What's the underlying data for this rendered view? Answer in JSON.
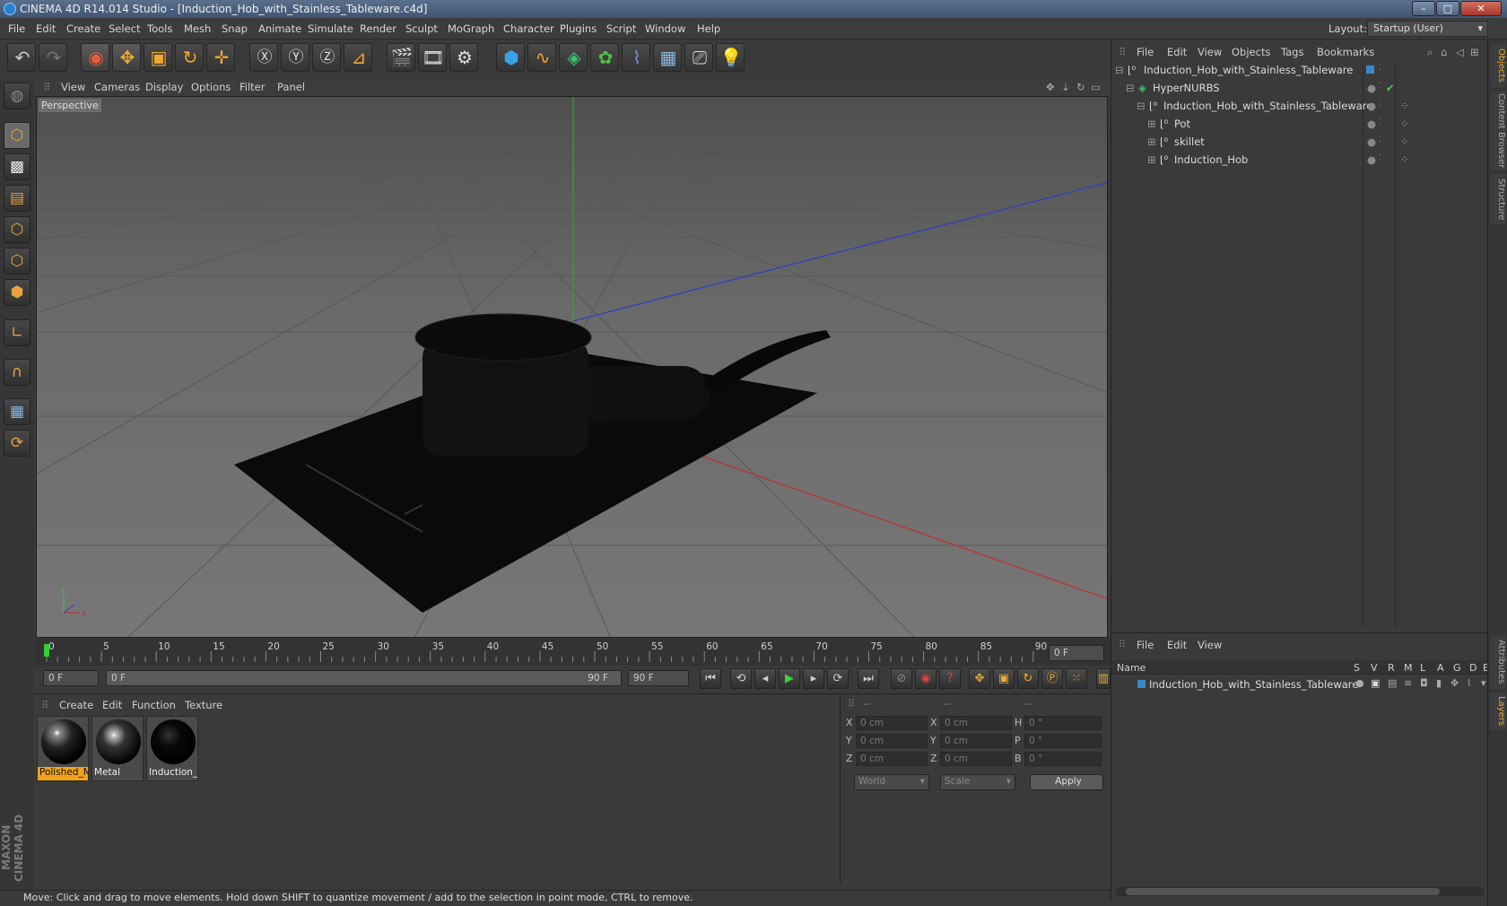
{
  "window": {
    "title": "CINEMA 4D R14.014 Studio - [Induction_Hob_with_Stainless_Tableware.c4d]",
    "controls": [
      "minimize",
      "maximize",
      "close"
    ]
  },
  "menubar": {
    "items": [
      "File",
      "Edit",
      "Create",
      "Select",
      "Tools",
      "Mesh",
      "Snap",
      "Animate",
      "Simulate",
      "Render",
      "Sculpt",
      "MoGraph",
      "Character",
      "Plugins",
      "Script",
      "Window",
      "Help"
    ],
    "layout_label": "Layout:",
    "layout_value": "Startup (User)"
  },
  "viewport": {
    "menu": [
      "View",
      "Cameras",
      "Display",
      "Options",
      "Filter",
      "Panel"
    ],
    "label": "Perspective"
  },
  "timeline": {
    "ticks": [
      "0",
      "5",
      "10",
      "15",
      "20",
      "25",
      "30",
      "35",
      "40",
      "45",
      "50",
      "55",
      "60",
      "65",
      "70",
      "75",
      "80",
      "85",
      "90"
    ],
    "frame_field": "0 F",
    "start_field": "0 F",
    "range_start": "0 F",
    "range_end": "90 F",
    "end_field": "90 F"
  },
  "materials": {
    "menu": [
      "Create",
      "Edit",
      "Function",
      "Texture"
    ],
    "items": [
      {
        "name": "Polished_M",
        "selected": true
      },
      {
        "name": "Metal",
        "selected": false
      },
      {
        "name": "Induction_",
        "selected": false
      }
    ]
  },
  "coordinates": {
    "headers": [
      "--",
      "--",
      "--"
    ],
    "rows": [
      {
        "a": "X",
        "av": "0 cm",
        "b": "X",
        "bv": "0 cm",
        "c": "H",
        "cv": "0 °"
      },
      {
        "a": "Y",
        "av": "0 cm",
        "b": "Y",
        "bv": "0 cm",
        "c": "P",
        "cv": "0 °"
      },
      {
        "a": "Z",
        "av": "0 cm",
        "b": "Z",
        "bv": "0 cm",
        "c": "B",
        "cv": "0 °"
      }
    ],
    "mode": "World",
    "scale": "Scale",
    "apply": "Apply"
  },
  "objects": {
    "menu": [
      "File",
      "Edit",
      "View",
      "Objects",
      "Tags",
      "Bookmarks"
    ],
    "tree": [
      {
        "name": "Induction_Hob_with_Stainless_Tableware",
        "depth": 0
      },
      {
        "name": "HyperNURBS",
        "depth": 1
      },
      {
        "name": "Induction_Hob_with_Stainless_Tableware",
        "depth": 2
      },
      {
        "name": "Pot",
        "depth": 3
      },
      {
        "name": "skillet",
        "depth": 3
      },
      {
        "name": "Induction_Hob",
        "depth": 3
      }
    ]
  },
  "layers": {
    "menu": [
      "File",
      "Edit",
      "View"
    ],
    "header_name": "Name",
    "columns": [
      "S",
      "V",
      "R",
      "M",
      "L",
      "A",
      "G",
      "D",
      "E"
    ],
    "row": "Induction_Hob_with_Stainless_Tableware"
  },
  "side_tabs": [
    "Objects",
    "Content Browser",
    "Structure",
    "Attributes",
    "Layers"
  ],
  "branding": "MAXON CINEMA 4D",
  "status": "Move: Click and drag to move elements. Hold down SHIFT to quantize movement / add to the selection in point mode, CTRL to remove.",
  "colors": {
    "accent": "#f0a830",
    "selected_material": "#f3a21c",
    "axis_x": "#c03030",
    "axis_y": "#2fa02f",
    "axis_z": "#3040c0"
  }
}
